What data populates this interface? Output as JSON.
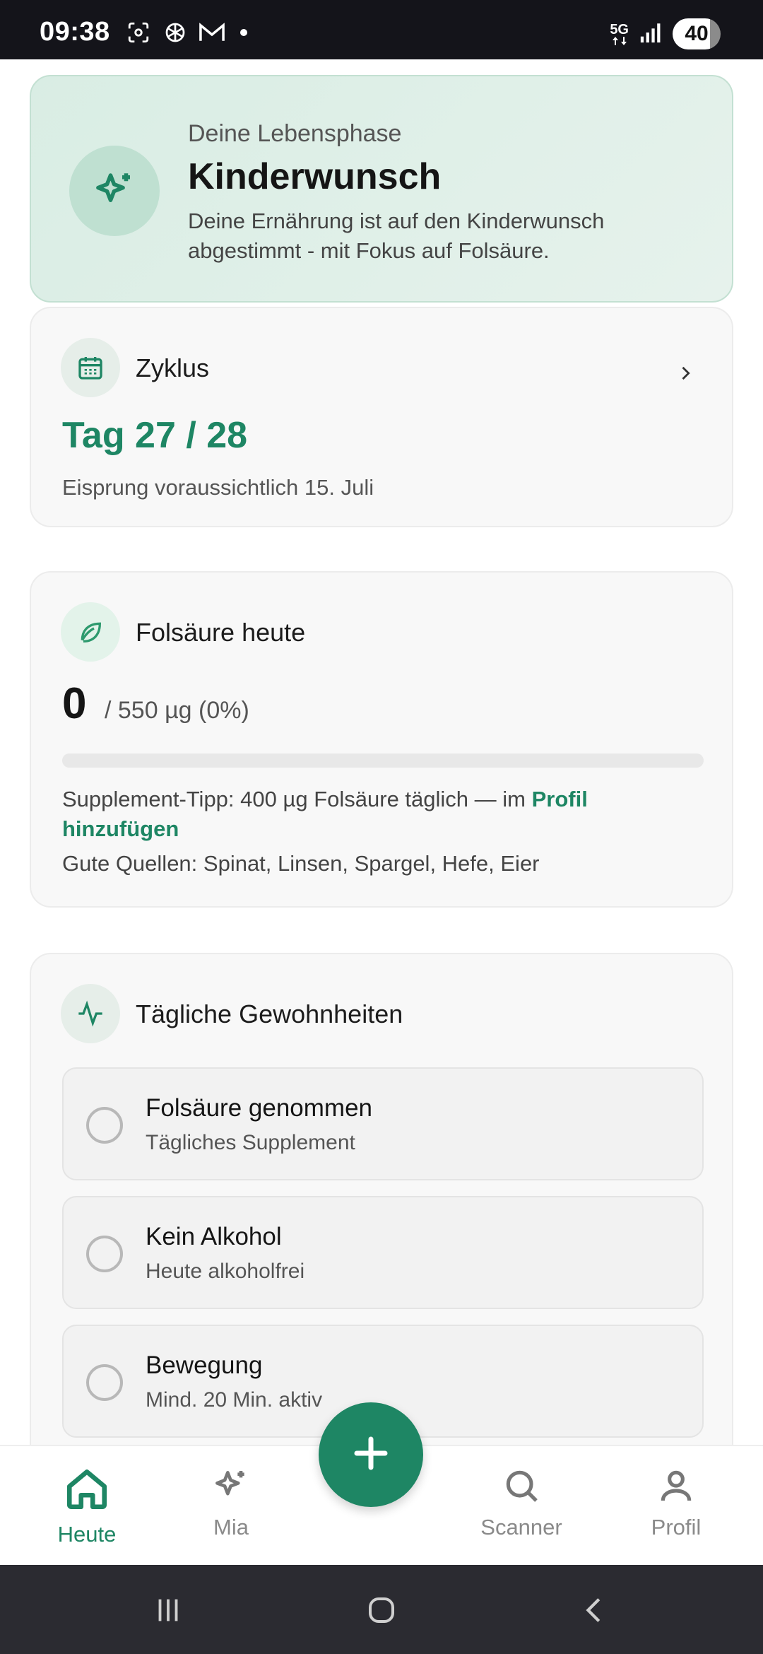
{
  "status_bar": {
    "time": "09:38",
    "network": "5G",
    "battery": "40",
    "icons": [
      "screenshot-icon",
      "openai-icon",
      "gmail-icon",
      "dot-icon",
      "network-5g-icon",
      "signal-icon",
      "battery-icon"
    ]
  },
  "phase_card": {
    "kicker": "Deine Lebensphase",
    "title": "Kinderwunsch",
    "description": "Deine Ernährung ist auf den Kinderwunsch abgestimmt - mit Fokus auf Folsäure.",
    "icon": "sparkle-icon"
  },
  "cycle_card": {
    "title": "Zyklus",
    "day": "Tag 27 / 28",
    "note": "Eisprung voraussichtlich 15. Juli",
    "icon": "calendar-icon"
  },
  "folic_card": {
    "title": "Folsäure heute",
    "amount": "0",
    "goal": "/ 550 µg (0%)",
    "progress_fraction": 0,
    "tip_text": "Supplement-Tipp: 400 µg Folsäure täglich — im ",
    "tip_link": "Profil hinzufügen",
    "sources": "Gute Quellen: Spinat, Linsen, Spargel, Hefe, Eier",
    "icon": "leaf-icon"
  },
  "habits_card": {
    "title": "Tägliche Gewohnheiten",
    "icon": "activity-icon",
    "items": [
      {
        "title": "Folsäure genommen",
        "subtitle": "Tägliches Supplement"
      },
      {
        "title": "Kein Alkohol",
        "subtitle": "Heute alkoholfrei"
      },
      {
        "title": "Bewegung",
        "subtitle": "Mind. 20 Min. aktiv"
      }
    ]
  },
  "bottom_nav": {
    "items": [
      {
        "label": "Heute",
        "icon": "home-icon",
        "active": true
      },
      {
        "label": "Mia",
        "icon": "sparkle-icon",
        "active": false
      },
      {
        "label": "Scanner",
        "icon": "search-icon",
        "active": false
      },
      {
        "label": "Profil",
        "icon": "user-icon",
        "active": false
      }
    ],
    "fab_icon": "plus-icon"
  },
  "colors": {
    "accent": "#1e8664",
    "phase_bg": "#d9ede4",
    "status_bar": "#14141a",
    "system_nav": "#2b2b31"
  }
}
